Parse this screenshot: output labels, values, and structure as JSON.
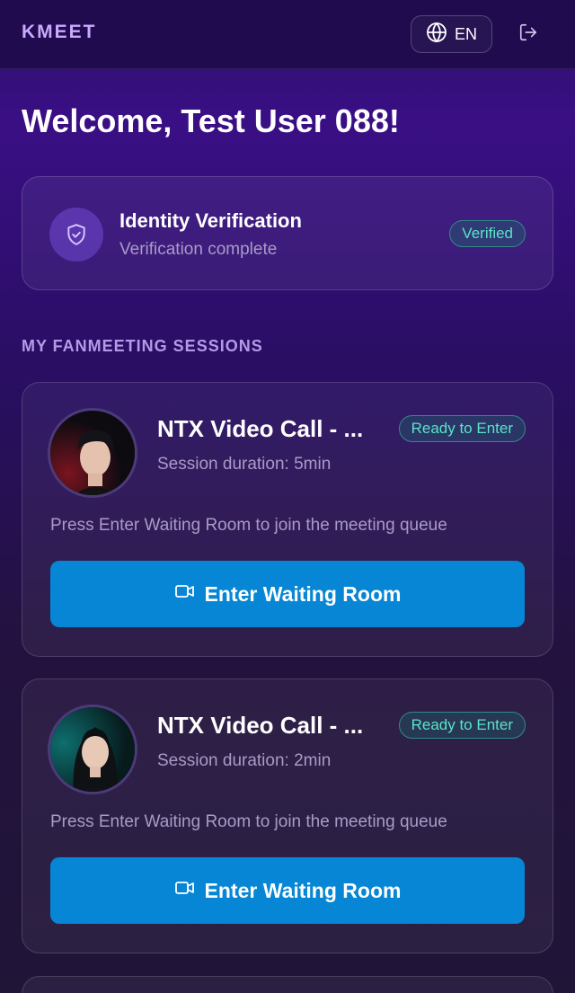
{
  "header": {
    "brand": "KMEET",
    "language_label": "EN"
  },
  "welcome": {
    "title": "Welcome, Test User 088!"
  },
  "verification": {
    "title": "Identity Verification",
    "subtitle": "Verification complete",
    "badge": "Verified"
  },
  "sessions_heading": "MY FANMEETING SESSIONS",
  "sessions": [
    {
      "title": "NTX Video Call - ...",
      "status": "Ready to Enter",
      "duration": "Session duration: 5min",
      "hint": "Press Enter Waiting Room to join the meeting queue",
      "button_label": "Enter Waiting Room"
    },
    {
      "title": "NTX Video Call - ...",
      "status": "Ready to Enter",
      "duration": "Session duration: 2min",
      "hint": "Press Enter Waiting Room to join the meeting queue",
      "button_label": "Enter Waiting Room"
    }
  ],
  "colors": {
    "accent_button": "#0686d4",
    "status_green": "#5be3c7",
    "brand_purple": "#c9a9ff"
  },
  "icons": {
    "language": "globe-icon",
    "logout": "logout-icon",
    "verification": "shield-check-icon",
    "button": "video-camera-icon"
  }
}
